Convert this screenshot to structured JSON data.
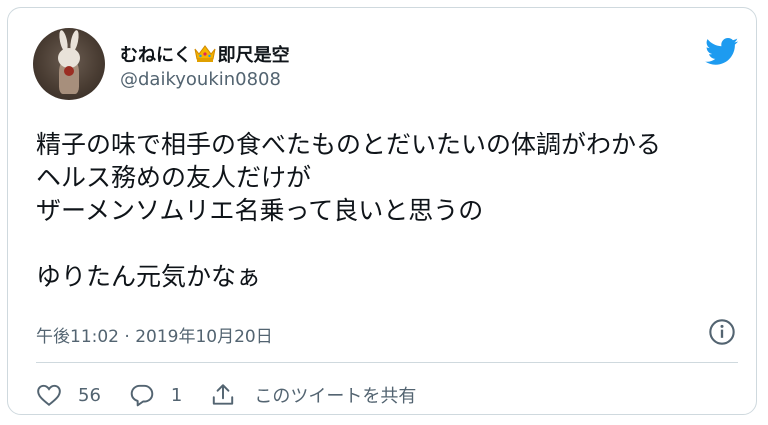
{
  "user": {
    "name_prefix": "むねにく",
    "name_suffix": "即尺是空",
    "handle": "@daikyoukin0808"
  },
  "tweet": {
    "lines": [
      "精子の味で相手の食べたものとだいたいの体調がわかる",
      "ヘルス務めの友人だけが",
      "ザーメンソムリエ名乗って良いと思うの",
      "",
      "ゆりたん元気かなぁ"
    ],
    "timestamp": "午後11:02 · 2019年10月20日"
  },
  "actions": {
    "likes": "56",
    "replies": "1",
    "share_label": "このツイートを共有"
  },
  "colors": {
    "twitter_blue": "#1d9bf0",
    "text": "#0f1419",
    "secondary": "#536471",
    "border": "#cfd9de"
  },
  "icons": [
    "twitter-bird-icon",
    "info-icon",
    "heart-icon",
    "reply-icon",
    "share-icon",
    "crown-icon"
  ]
}
